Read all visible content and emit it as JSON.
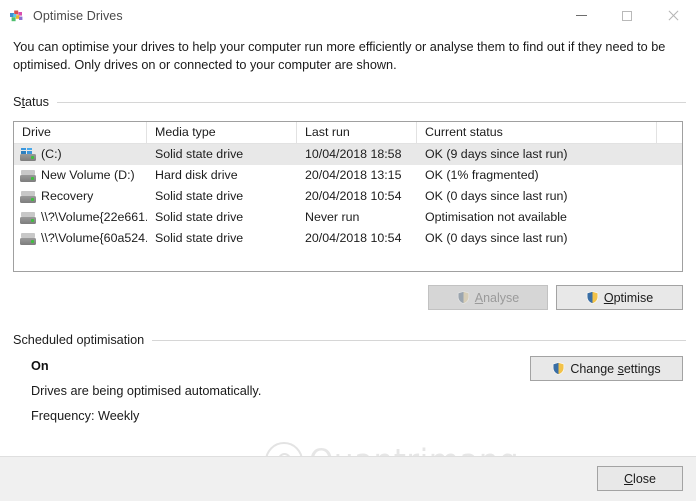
{
  "window": {
    "title": "Optimise Drives",
    "icon": "defrag-drives-icon",
    "controls": {
      "minimize": "Minimise",
      "maximize": "Maximise",
      "close": "Close"
    }
  },
  "description": "You can optimise your drives to help your computer run more efficiently or analyse them to find out if they need to be optimised. Only drives on or connected to your computer are shown.",
  "status_group": {
    "label_prefix": "S",
    "label_accesskey": "t",
    "label_suffix": "atus",
    "label_full": "Status"
  },
  "table": {
    "columns": [
      {
        "label": "Drive"
      },
      {
        "label": "Media type"
      },
      {
        "label": "Last run"
      },
      {
        "label": "Current status"
      }
    ],
    "rows": [
      {
        "drive": "(C:)",
        "media_type": "Solid state drive",
        "last_run": "10/04/2018 18:58",
        "current_status": "OK (9 days since last run)",
        "icon": "system-drive-icon",
        "selected": true
      },
      {
        "drive": "New Volume (D:)",
        "media_type": "Hard disk drive",
        "last_run": "20/04/2018 13:15",
        "current_status": "OK (1% fragmented)",
        "icon": "drive-icon",
        "selected": false
      },
      {
        "drive": "Recovery",
        "media_type": "Solid state drive",
        "last_run": "20/04/2018 10:54",
        "current_status": "OK (0 days since last run)",
        "icon": "drive-icon",
        "selected": false
      },
      {
        "drive": "\\\\?\\Volume{22e661...",
        "media_type": "Solid state drive",
        "last_run": "Never run",
        "current_status": "Optimisation not available",
        "icon": "drive-icon",
        "selected": false
      },
      {
        "drive": "\\\\?\\Volume{60a524...",
        "media_type": "Solid state drive",
        "last_run": "20/04/2018 10:54",
        "current_status": "OK (0 days since last run)",
        "icon": "drive-icon",
        "selected": false
      }
    ]
  },
  "buttons": {
    "analyse": {
      "prefix": "",
      "accesskey": "A",
      "suffix": "nalyse",
      "full": "Analyse",
      "enabled": false,
      "icon": "uac-shield-icon"
    },
    "optimise": {
      "prefix": "",
      "accesskey": "O",
      "suffix": "ptimise",
      "full": "Optimise",
      "enabled": true,
      "icon": "uac-shield-icon"
    },
    "change_settings": {
      "prefix": "Change ",
      "accesskey": "s",
      "suffix": "ettings",
      "full": "Change settings",
      "enabled": true,
      "icon": "uac-shield-icon"
    },
    "close": {
      "prefix": "",
      "accesskey": "C",
      "suffix": "lose",
      "full": "Close",
      "enabled": true
    }
  },
  "scheduled": {
    "group_label": "Scheduled optimisation",
    "state": "On",
    "detail": "Drives are being optimised automatically.",
    "frequency": "Frequency: Weekly"
  },
  "watermark": {
    "text": "Quantrimang",
    "logo": "lightbulb-icon"
  },
  "colors": {
    "accent_shield_blue": "#3a6ea5",
    "accent_shield_gold": "#f2c249",
    "selected_row": "#e8e8e8",
    "dialog_bg": "#ffffff",
    "footer_bg": "#f0f0f0",
    "button_bg": "#e1e1e1",
    "border": "#a0a0a0",
    "drive_led_green": "#3fbf3f"
  }
}
